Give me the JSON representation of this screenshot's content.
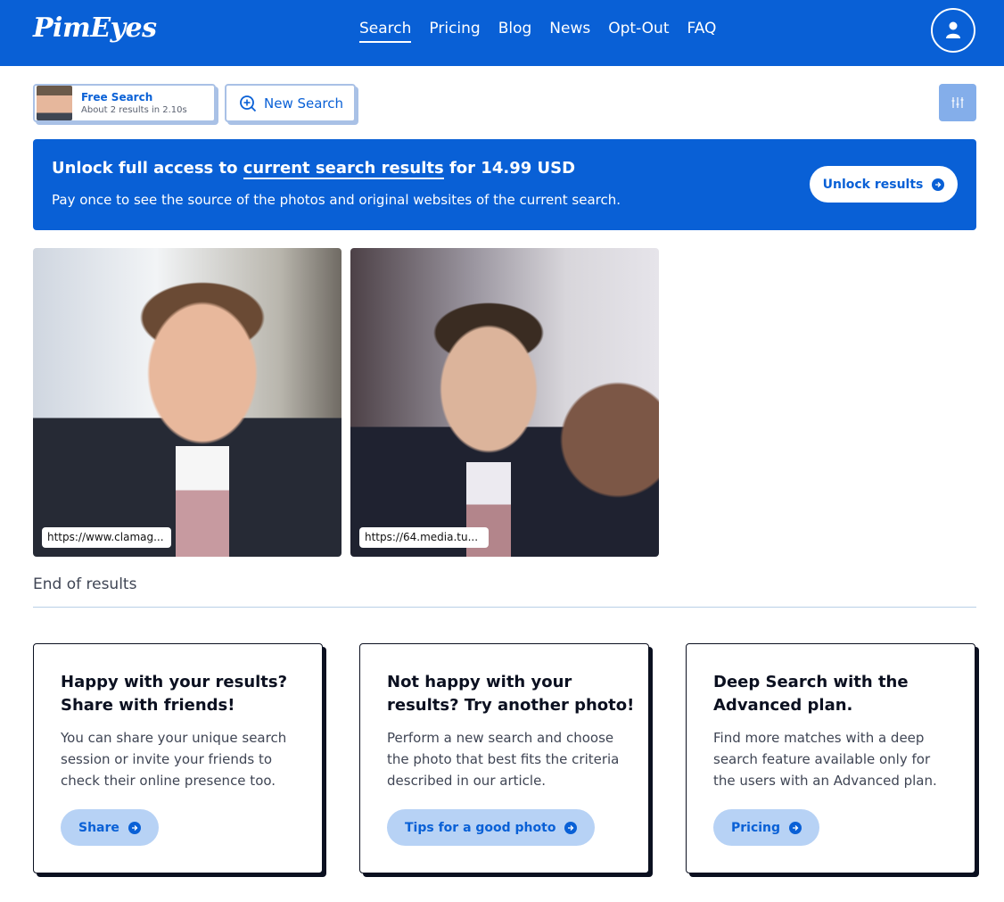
{
  "brand": {
    "logo_text": "PimEyes",
    "primary_color": "#0960d6"
  },
  "nav": {
    "items": [
      {
        "label": "Search",
        "active": true
      },
      {
        "label": "Pricing"
      },
      {
        "label": "Blog"
      },
      {
        "label": "News"
      },
      {
        "label": "Opt-Out"
      },
      {
        "label": "FAQ"
      }
    ],
    "account_icon": "user-icon"
  },
  "toolbar": {
    "free_search": {
      "title": "Free Search",
      "subtitle": "About 2 results in 2.10s"
    },
    "new_search_label": "New Search",
    "filter_icon": "sliders-icon"
  },
  "banner": {
    "title_prefix": "Unlock full access to ",
    "title_link": "current search results",
    "title_suffix": " for 14.99 USD",
    "subtitle": "Pay once to see the source of the photos and original websites of the current search.",
    "button_label": "Unlock results"
  },
  "results": [
    {
      "url": "https://www.clamag..."
    },
    {
      "url": "https://64.media.tu..."
    }
  ],
  "end_label": "End of results",
  "cards": [
    {
      "title": "Happy with your results? Share with friends!",
      "text": "You can share your unique search session or invite your friends to check their online presence too.",
      "button_label": "Share"
    },
    {
      "title": "Not happy with your results? Try another photo!",
      "text": "Perform a new search and choose the photo that best fits the criteria described in our article.",
      "button_label": "Tips for a good photo"
    },
    {
      "title": "Deep Search with the Advanced plan.",
      "text": "Find more matches with a deep search feature available only for the users with an Advanced plan.",
      "button_label": "Pricing"
    }
  ]
}
